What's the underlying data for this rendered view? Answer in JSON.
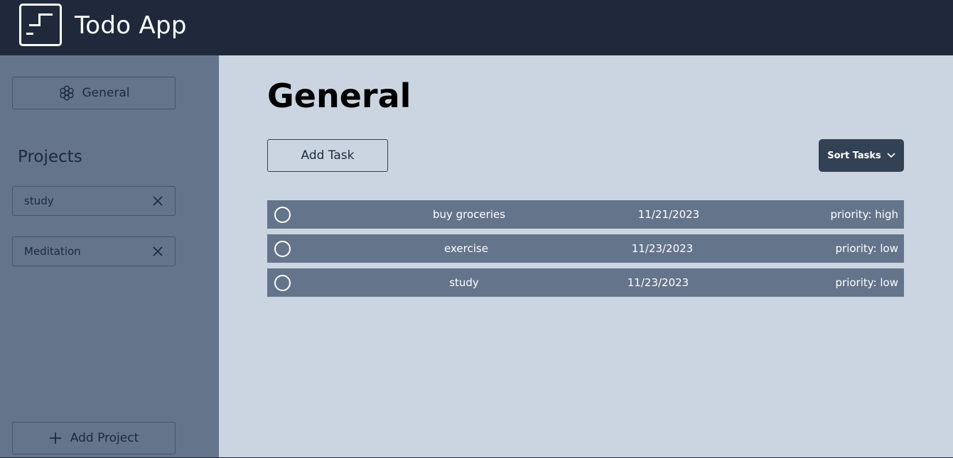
{
  "header": {
    "app_title": "Todo App",
    "logo_icon": "todo-logo-icon"
  },
  "sidebar": {
    "general_label": "General",
    "general_icon": "flower-icon",
    "projects_heading": "Projects",
    "projects": [
      {
        "label": "study"
      },
      {
        "label": "Meditation"
      }
    ],
    "add_project_label": "Add Project",
    "add_project_icon": "plus-icon"
  },
  "main": {
    "title": "General",
    "add_task_label": "Add Task",
    "sort_label": "Sort Tasks",
    "sort_icon": "chevron-down-icon",
    "tasks": [
      {
        "name": "buy groceries",
        "date": "11/21/2023",
        "priority": "priority: high"
      },
      {
        "name": "exercise",
        "date": "11/23/2023",
        "priority": "priority: low"
      },
      {
        "name": "study",
        "date": "11/23/2023",
        "priority": "priority: low"
      }
    ]
  },
  "colors": {
    "header_bg": "#1f293b",
    "sidebar_bg": "#64748b",
    "main_bg": "#cbd5e1",
    "task_row_bg": "#64748b",
    "sort_button_bg": "#334155"
  }
}
